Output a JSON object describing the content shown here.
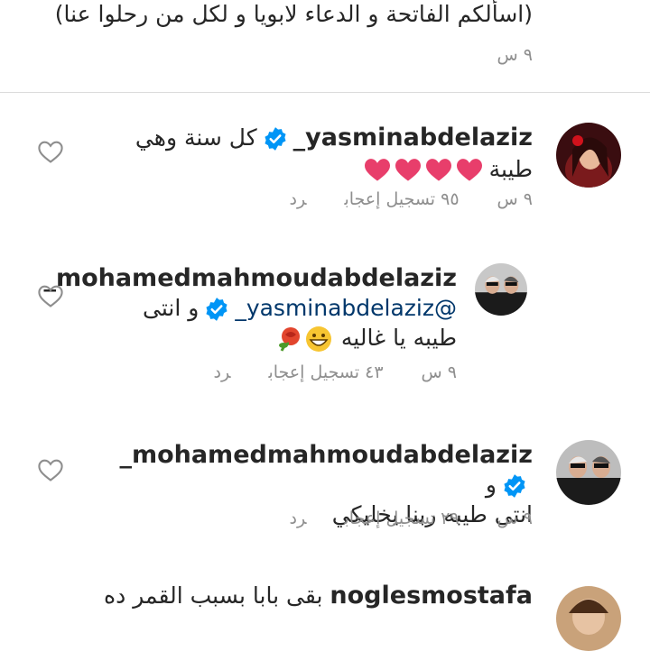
{
  "previous_comment": {
    "text_tail": "(اسألكم الفاتحة و الدعاء لابويا و لكل من رحلوا عنا)",
    "time": "٩ س"
  },
  "comments": [
    {
      "username": "yasminabdelaziz_",
      "verified": true,
      "text": "كل سنة وهي طيبة",
      "emoji_line": "💗💗💗💗",
      "time": "٩ س",
      "likes": "٩٥ تسجيل إعجاب",
      "reply": "رد"
    },
    {
      "username": "mohamedmahmoudabdelaziz_",
      "verified": false,
      "mention": "@yasminabdelaziz_",
      "mention_verified": true,
      "text_after_mention": "و انتى",
      "text_line2": "طيبه يا غاليه",
      "emojis": "😁🌹",
      "time": "٩ س",
      "likes": "٤٣ تسجيل إعجاب",
      "reply": "رد"
    },
    {
      "username": "mohamedmahmoudabdelaziz_",
      "verified": true,
      "text": "و",
      "text_line2": "انتى طيبه ربنا يخليكي",
      "time": "٩ س",
      "likes": "٢٩ تسجيل إعجاب",
      "reply": "رد"
    },
    {
      "username": "noglesmostafa",
      "text": "بقى بابا بسبب القمر ده"
    }
  ],
  "icons": {
    "like": "heart-outline-icon",
    "verified": "verified-badge-icon"
  },
  "colors": {
    "verified_blue": "#0095f6",
    "mention": "#00376b",
    "meta_gray": "#8e8e8e"
  }
}
